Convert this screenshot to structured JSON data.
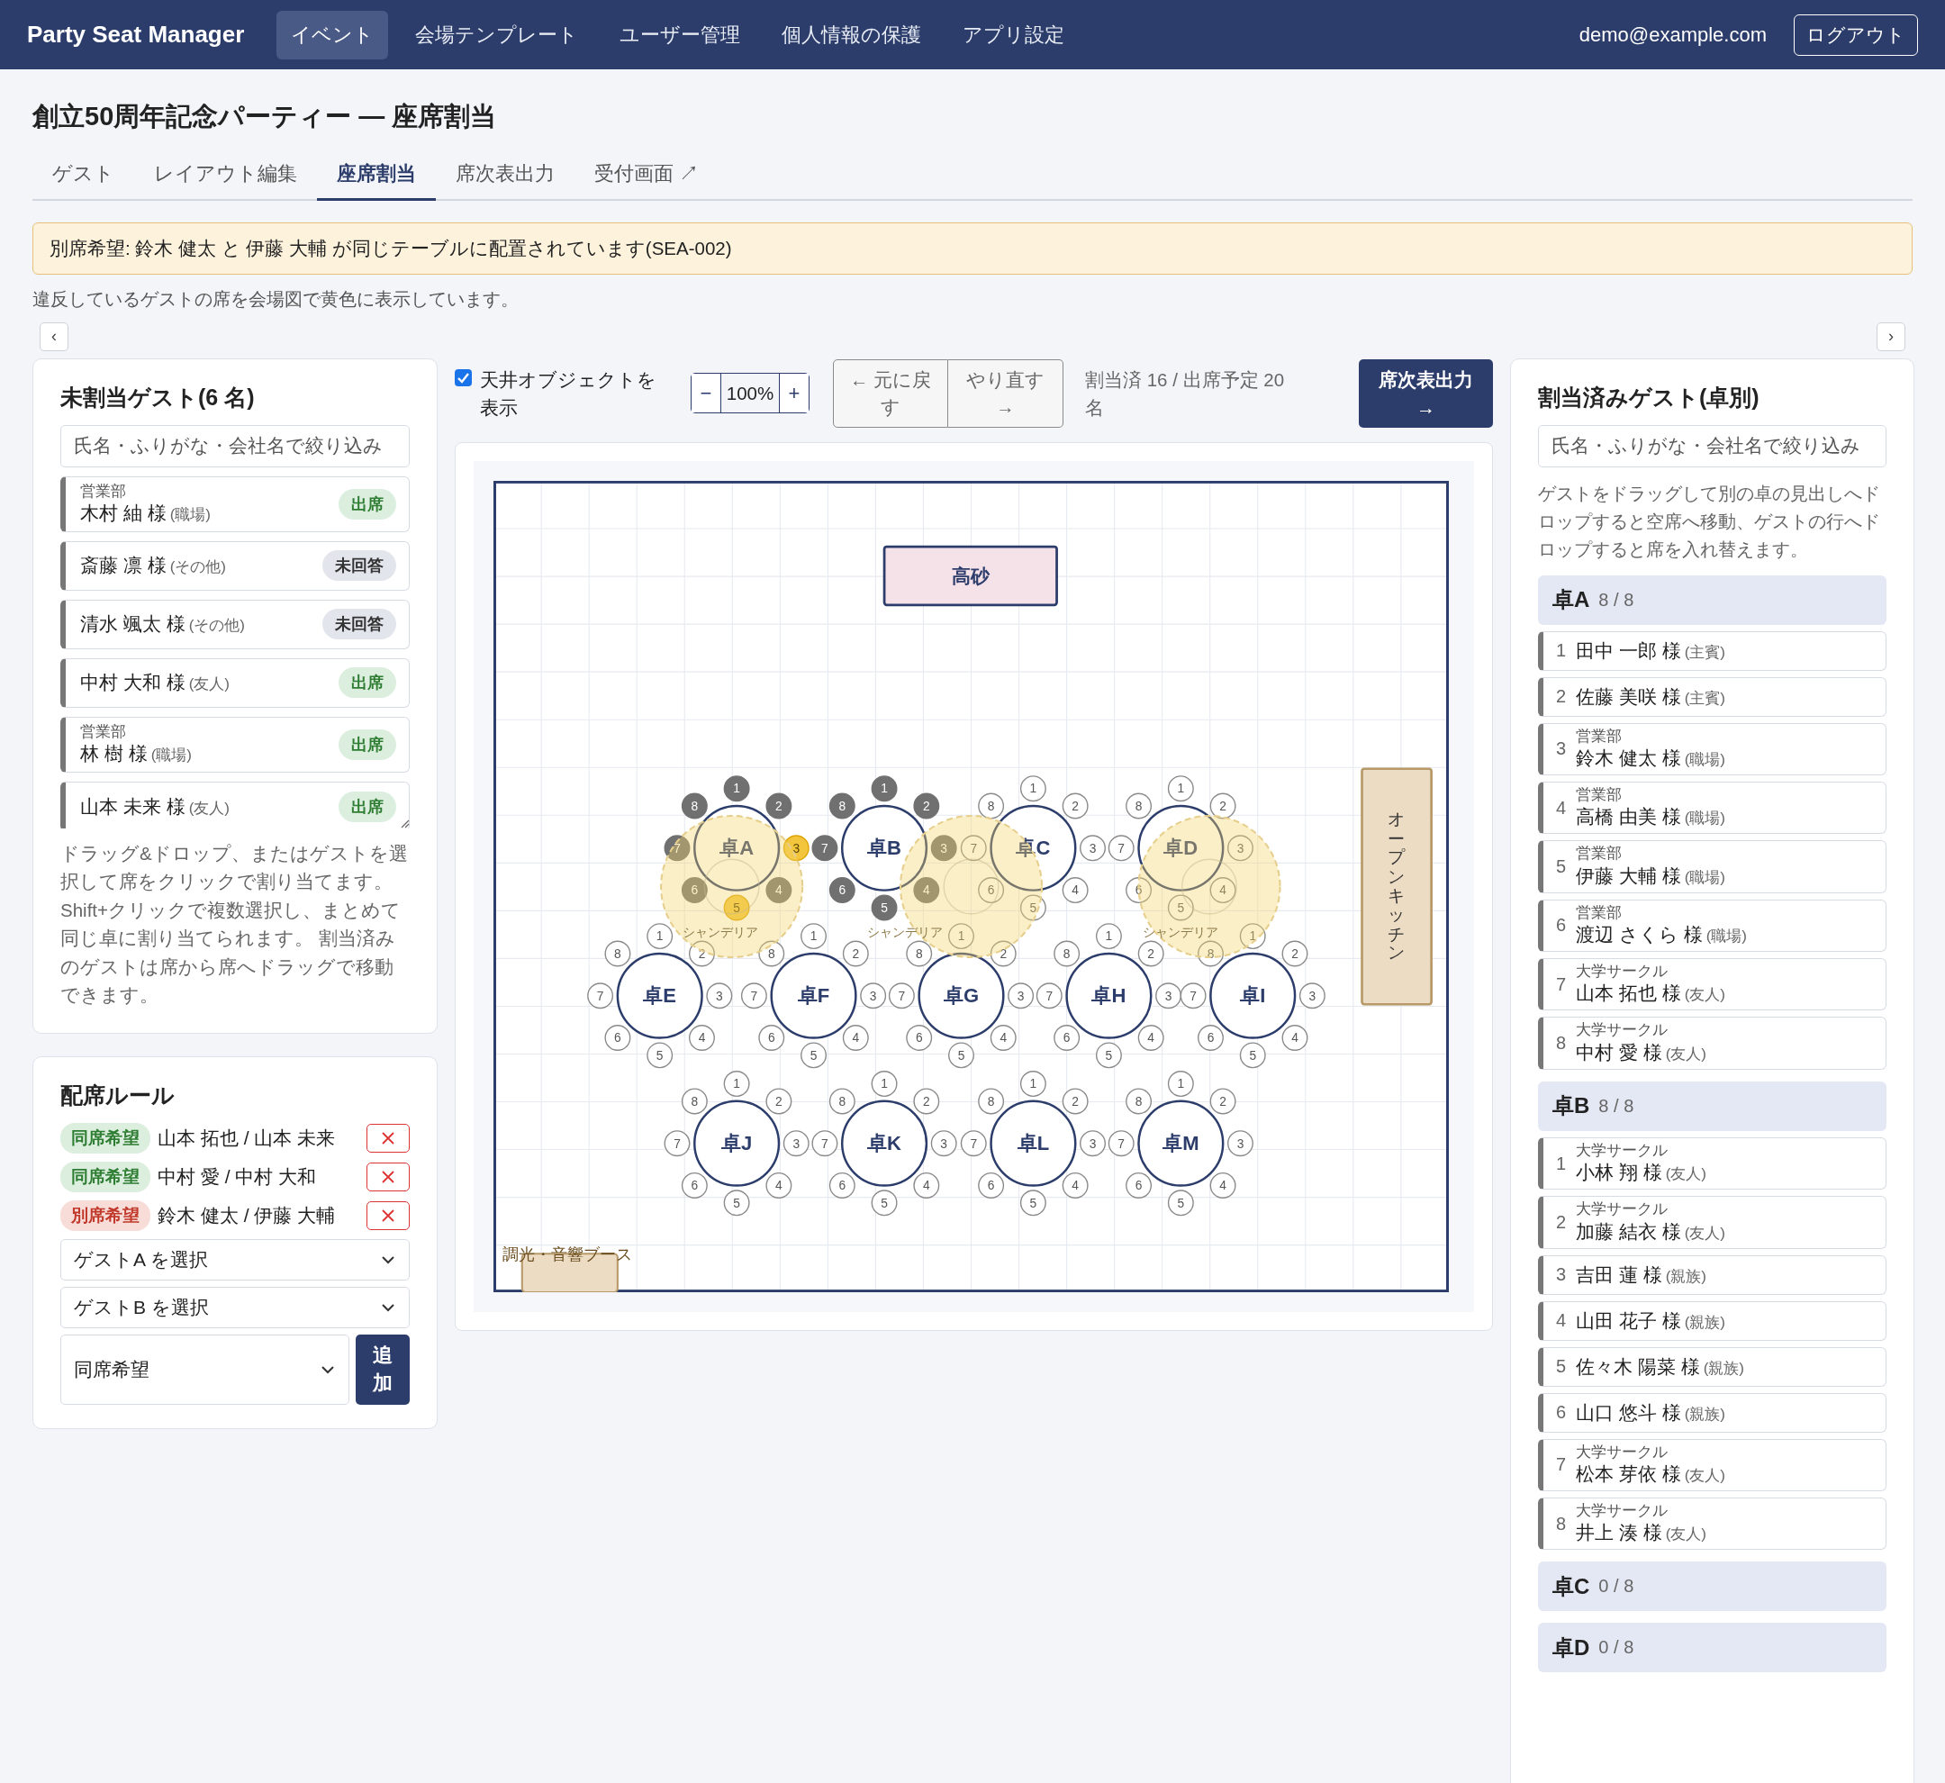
{
  "app": {
    "brand": "Party Seat Manager",
    "nav": [
      {
        "label": "イベント",
        "selected": true
      },
      {
        "label": "会場テンプレート",
        "selected": false
      },
      {
        "label": "ユーザー管理",
        "selected": false
      },
      {
        "label": "個人情報の保護",
        "selected": false
      },
      {
        "label": "アプリ設定",
        "selected": false
      }
    ],
    "user": "demo@example.com",
    "logout": "ログアウト"
  },
  "page": {
    "title": "創立50周年記念パーティー — 座席割当",
    "tabs": [
      {
        "label": "ゲスト",
        "selected": false
      },
      {
        "label": "レイアウト編集",
        "selected": false
      },
      {
        "label": "座席割当",
        "selected": true
      },
      {
        "label": "席次表出力",
        "selected": false
      },
      {
        "label": "受付画面 ↗",
        "selected": false
      }
    ]
  },
  "alert": "別席希望: 鈴木 健太 と 伊藤 大輔 が同じテーブルに配置されています(SEA-002)",
  "note": "違反しているゲストの席を会場図で黄色に表示しています。",
  "collapse_left": "‹",
  "collapse_right": "›",
  "unassigned": {
    "title": "未割当ゲスト(6 名)",
    "placeholder": "氏名・ふりがな・会社名で絞り込み",
    "guests": [
      {
        "group": "営業部",
        "name": "木村 紬 様",
        "relation": "(職場)",
        "kind": "attending",
        "badge": "出席"
      },
      {
        "name": "斎藤 凛 様",
        "relation": "(その他)",
        "kind": "pending",
        "badge": "未回答"
      },
      {
        "name": "清水 颯太 様",
        "relation": "(その他)",
        "kind": "pending",
        "badge": "未回答"
      },
      {
        "name": "中村 大和 様",
        "relation": "(友人)",
        "kind": "attending",
        "badge": "出席"
      },
      {
        "group": "営業部",
        "name": "林 樹 様",
        "relation": "(職場)",
        "kind": "attending",
        "badge": "出席"
      },
      {
        "name": "山本 未来 様",
        "relation": "(友人)",
        "kind": "attending",
        "badge": "出席"
      }
    ],
    "hint": "ドラッグ&ドロップ、またはゲストを選択して席をクリックで割り当てます。Shift+クリックで複数選択し、まとめて同じ卓に割り当てられます。 割当済みのゲストは席から席へドラッグで移動できます。"
  },
  "rules": {
    "title": "配席ルール",
    "items": [
      {
        "kind": "same",
        "tag": "同席希望",
        "pair": "山本 拓也 / 山本 未来"
      },
      {
        "kind": "same",
        "tag": "同席希望",
        "pair": "中村 愛 / 中村 大和"
      },
      {
        "kind": "separate",
        "tag": "別席希望",
        "pair": "鈴木 健太 / 伊藤 大輔"
      }
    ],
    "guest_a": "ゲストA を選択",
    "guest_b": "ゲストB を選択",
    "type": "同席希望",
    "add": "追加"
  },
  "toolbar": {
    "show_ceiling": {
      "label": "天井オブジェクトを表示",
      "checked": true
    },
    "zoom_out": "−",
    "zoom": "100%",
    "zoom_in": "+",
    "undo": "← 元に戻す",
    "redo": "やり直す →",
    "count": "割当済 16 / 出席予定 20 名",
    "export": "席次表出力 →"
  },
  "canvas": {
    "objects": [
      {
        "kind": "stage",
        "label": "高砂"
      },
      {
        "kind": "kitchen",
        "label": "オープンキッチン"
      },
      {
        "kind": "booth",
        "label": "調光・音響ブース"
      }
    ],
    "tables": [
      {
        "label": "卓A",
        "seats": [
          {
            "label": "1",
            "occupied": true,
            "conflict": false
          },
          {
            "label": "2",
            "occupied": true,
            "conflict": false
          },
          {
            "label": "3",
            "occupied": true,
            "conflict": true
          },
          {
            "label": "4",
            "occupied": true,
            "conflict": false
          },
          {
            "label": "5",
            "occupied": true,
            "conflict": true
          },
          {
            "label": "6",
            "occupied": true,
            "conflict": false
          },
          {
            "label": "7",
            "occupied": true,
            "conflict": false
          },
          {
            "label": "8",
            "occupied": true,
            "conflict": false
          }
        ]
      },
      {
        "label": "卓B",
        "seats": [
          {
            "label": "1",
            "occupied": true,
            "conflict": false
          },
          {
            "label": "2",
            "occupied": true,
            "conflict": false
          },
          {
            "label": "3",
            "occupied": true,
            "conflict": false
          },
          {
            "label": "4",
            "occupied": true,
            "conflict": false
          },
          {
            "label": "5",
            "occupied": true,
            "conflict": false
          },
          {
            "label": "6",
            "occupied": true,
            "conflict": false
          },
          {
            "label": "7",
            "occupied": true,
            "conflict": false
          },
          {
            "label": "8",
            "occupied": true,
            "conflict": false
          }
        ]
      },
      {
        "label": "卓C",
        "seats": [
          {
            "label": "1",
            "occupied": false,
            "conflict": false
          },
          {
            "label": "2",
            "occupied": false,
            "conflict": false
          },
          {
            "label": "3",
            "occupied": false,
            "conflict": false
          },
          {
            "label": "4",
            "occupied": false,
            "conflict": false
          },
          {
            "label": "5",
            "occupied": false,
            "conflict": false
          },
          {
            "label": "6",
            "occupied": false,
            "conflict": false
          },
          {
            "label": "7",
            "occupied": false,
            "conflict": false
          },
          {
            "label": "8",
            "occupied": false,
            "conflict": false
          }
        ]
      },
      {
        "label": "卓D",
        "seats": [
          {
            "label": "1",
            "occupied": false,
            "conflict": false
          },
          {
            "label": "2",
            "occupied": false,
            "conflict": false
          },
          {
            "label": "3",
            "occupied": false,
            "conflict": false
          },
          {
            "label": "4",
            "occupied": false,
            "conflict": false
          },
          {
            "label": "5",
            "occupied": false,
            "conflict": false
          },
          {
            "label": "6",
            "occupied": false,
            "conflict": false
          },
          {
            "label": "7",
            "occupied": false,
            "conflict": false
          },
          {
            "label": "8",
            "occupied": false,
            "conflict": false
          }
        ]
      },
      {
        "label": "卓E",
        "seats": [
          {
            "label": "1",
            "occupied": false,
            "conflict": false
          },
          {
            "label": "2",
            "occupied": false,
            "conflict": false
          },
          {
            "label": "3",
            "occupied": false,
            "conflict": false
          },
          {
            "label": "4",
            "occupied": false,
            "conflict": false
          },
          {
            "label": "5",
            "occupied": false,
            "conflict": false
          },
          {
            "label": "6",
            "occupied": false,
            "conflict": false
          },
          {
            "label": "7",
            "occupied": false,
            "conflict": false
          },
          {
            "label": "8",
            "occupied": false,
            "conflict": false
          }
        ]
      },
      {
        "label": "卓F",
        "seats": [
          {
            "label": "1",
            "occupied": false,
            "conflict": false
          },
          {
            "label": "2",
            "occupied": false,
            "conflict": false
          },
          {
            "label": "3",
            "occupied": false,
            "conflict": false
          },
          {
            "label": "4",
            "occupied": false,
            "conflict": false
          },
          {
            "label": "5",
            "occupied": false,
            "conflict": false
          },
          {
            "label": "6",
            "occupied": false,
            "conflict": false
          },
          {
            "label": "7",
            "occupied": false,
            "conflict": false
          },
          {
            "label": "8",
            "occupied": false,
            "conflict": false
          }
        ]
      },
      {
        "label": "卓G",
        "seats": [
          {
            "label": "1",
            "occupied": false,
            "conflict": false
          },
          {
            "label": "2",
            "occupied": false,
            "conflict": false
          },
          {
            "label": "3",
            "occupied": false,
            "conflict": false
          },
          {
            "label": "4",
            "occupied": false,
            "conflict": false
          },
          {
            "label": "5",
            "occupied": false,
            "conflict": false
          },
          {
            "label": "6",
            "occupied": false,
            "conflict": false
          },
          {
            "label": "7",
            "occupied": false,
            "conflict": false
          },
          {
            "label": "8",
            "occupied": false,
            "conflict": false
          }
        ]
      },
      {
        "label": "卓H",
        "seats": [
          {
            "label": "1",
            "occupied": false,
            "conflict": false
          },
          {
            "label": "2",
            "occupied": false,
            "conflict": false
          },
          {
            "label": "3",
            "occupied": false,
            "conflict": false
          },
          {
            "label": "4",
            "occupied": false,
            "conflict": false
          },
          {
            "label": "5",
            "occupied": false,
            "conflict": false
          },
          {
            "label": "6",
            "occupied": false,
            "conflict": false
          },
          {
            "label": "7",
            "occupied": false,
            "conflict": false
          },
          {
            "label": "8",
            "occupied": false,
            "conflict": false
          }
        ]
      },
      {
        "label": "卓I",
        "seats": [
          {
            "label": "1",
            "occupied": false,
            "conflict": false
          },
          {
            "label": "2",
            "occupied": false,
            "conflict": false
          },
          {
            "label": "3",
            "occupied": false,
            "conflict": false
          },
          {
            "label": "4",
            "occupied": false,
            "conflict": false
          },
          {
            "label": "5",
            "occupied": false,
            "conflict": false
          },
          {
            "label": "6",
            "occupied": false,
            "conflict": false
          },
          {
            "label": "7",
            "occupied": false,
            "conflict": false
          },
          {
            "label": "8",
            "occupied": false,
            "conflict": false
          }
        ]
      },
      {
        "label": "卓J",
        "seats": [
          {
            "label": "1",
            "occupied": false,
            "conflict": false
          },
          {
            "label": "2",
            "occupied": false,
            "conflict": false
          },
          {
            "label": "3",
            "occupied": false,
            "conflict": false
          },
          {
            "label": "4",
            "occupied": false,
            "conflict": false
          },
          {
            "label": "5",
            "occupied": false,
            "conflict": false
          },
          {
            "label": "6",
            "occupied": false,
            "conflict": false
          },
          {
            "label": "7",
            "occupied": false,
            "conflict": false
          },
          {
            "label": "8",
            "occupied": false,
            "conflict": false
          }
        ]
      },
      {
        "label": "卓K",
        "seats": [
          {
            "label": "1",
            "occupied": false,
            "conflict": false
          },
          {
            "label": "2",
            "occupied": false,
            "conflict": false
          },
          {
            "label": "3",
            "occupied": false,
            "conflict": false
          },
          {
            "label": "4",
            "occupied": false,
            "conflict": false
          },
          {
            "label": "5",
            "occupied": false,
            "conflict": false
          },
          {
            "label": "6",
            "occupied": false,
            "conflict": false
          },
          {
            "label": "7",
            "occupied": false,
            "conflict": false
          },
          {
            "label": "8",
            "occupied": false,
            "conflict": false
          }
        ]
      },
      {
        "label": "卓L",
        "seats": [
          {
            "label": "1",
            "occupied": false,
            "conflict": false
          },
          {
            "label": "2",
            "occupied": false,
            "conflict": false
          },
          {
            "label": "3",
            "occupied": false,
            "conflict": false
          },
          {
            "label": "4",
            "occupied": false,
            "conflict": false
          },
          {
            "label": "5",
            "occupied": false,
            "conflict": false
          },
          {
            "label": "6",
            "occupied": false,
            "conflict": false
          },
          {
            "label": "7",
            "occupied": false,
            "conflict": false
          },
          {
            "label": "8",
            "occupied": false,
            "conflict": false
          }
        ]
      },
      {
        "label": "卓M",
        "seats": [
          {
            "label": "1",
            "occupied": false,
            "conflict": false
          },
          {
            "label": "2",
            "occupied": false,
            "conflict": false
          },
          {
            "label": "3",
            "occupied": false,
            "conflict": false
          },
          {
            "label": "4",
            "occupied": false,
            "conflict": false
          },
          {
            "label": "5",
            "occupied": false,
            "conflict": false
          },
          {
            "label": "6",
            "occupied": false,
            "conflict": false
          },
          {
            "label": "7",
            "occupied": false,
            "conflict": false
          },
          {
            "label": "8",
            "occupied": false,
            "conflict": false
          }
        ]
      }
    ],
    "ceiling": [
      {
        "label": "シャンデリア"
      },
      {
        "label": "シャンデリア"
      },
      {
        "label": "シャンデリア"
      }
    ]
  },
  "assigned": {
    "title": "割当済みゲスト(卓別)",
    "placeholder": "氏名・ふりがな・会社名で絞り込み",
    "hint": "ゲストをドラッグして別の卓の見出しへドロップすると空席へ移動、ゲストの行へドロップすると席を入れ替えます。",
    "tables": [
      {
        "label": "卓A",
        "count": "8 / 8",
        "guests": [
          {
            "seat": "1",
            "name": "田中 一郎 様",
            "relation": "(主賓)"
          },
          {
            "seat": "2",
            "name": "佐藤 美咲 様",
            "relation": "(主賓)"
          },
          {
            "seat": "3",
            "group": "営業部",
            "name": "鈴木 健太 様",
            "relation": "(職場)"
          },
          {
            "seat": "4",
            "group": "営業部",
            "name": "高橋 由美 様",
            "relation": "(職場)"
          },
          {
            "seat": "5",
            "group": "営業部",
            "name": "伊藤 大輔 様",
            "relation": "(職場)"
          },
          {
            "seat": "6",
            "group": "営業部",
            "name": "渡辺 さくら 様",
            "relation": "(職場)"
          },
          {
            "seat": "7",
            "group": "大学サークル",
            "name": "山本 拓也 様",
            "relation": "(友人)"
          },
          {
            "seat": "8",
            "group": "大学サークル",
            "name": "中村 愛 様",
            "relation": "(友人)"
          }
        ]
      },
      {
        "label": "卓B",
        "count": "8 / 8",
        "guests": [
          {
            "seat": "1",
            "group": "大学サークル",
            "name": "小林 翔 様",
            "relation": "(友人)"
          },
          {
            "seat": "2",
            "group": "大学サークル",
            "name": "加藤 結衣 様",
            "relation": "(友人)"
          },
          {
            "seat": "3",
            "name": "吉田 蓮 様",
            "relation": "(親族)"
          },
          {
            "seat": "4",
            "name": "山田 花子 様",
            "relation": "(親族)"
          },
          {
            "seat": "5",
            "name": "佐々木 陽菜 様",
            "relation": "(親族)"
          },
          {
            "seat": "6",
            "name": "山口 悠斗 様",
            "relation": "(親族)"
          },
          {
            "seat": "7",
            "group": "大学サークル",
            "name": "松本 芽依 様",
            "relation": "(友人)"
          },
          {
            "seat": "8",
            "group": "大学サークル",
            "name": "井上 湊 様",
            "relation": "(友人)"
          }
        ]
      },
      {
        "label": "卓C",
        "count": "0 / 8"
      },
      {
        "label": "卓D",
        "count": "0 / 8"
      }
    ]
  }
}
